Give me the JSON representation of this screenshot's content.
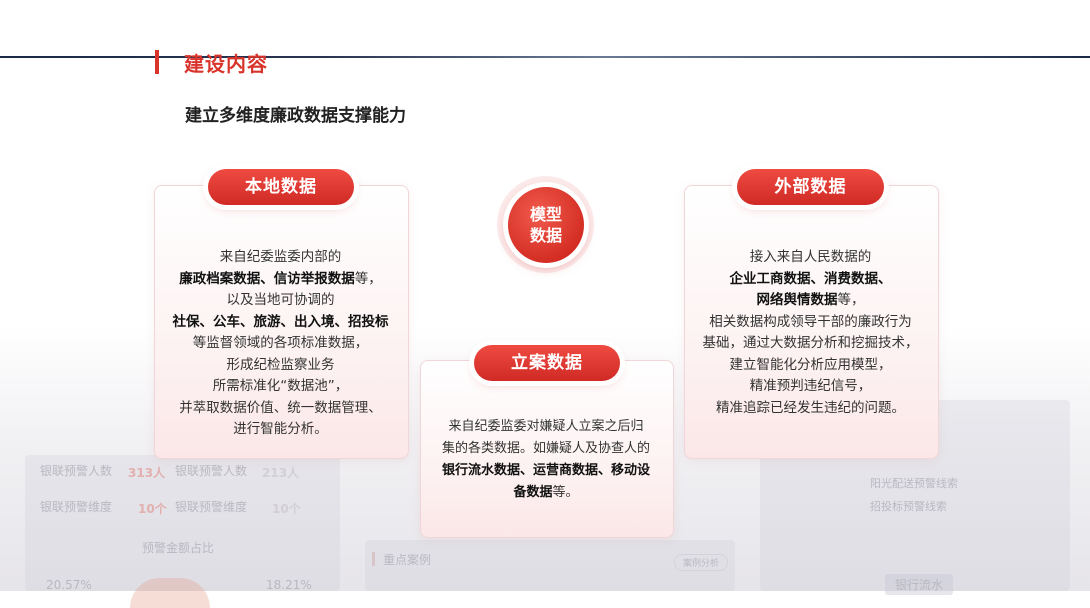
{
  "header": {
    "section_title": "建设内容",
    "subtitle": "建立多维度廉政数据支撑能力"
  },
  "center_badge": {
    "line1": "模型",
    "line2": "数据"
  },
  "cards": {
    "local": {
      "title": "本地数据",
      "l1": "来自纪委监委内部的",
      "l2_b1": "廉政档案数据",
      "l2_sep": "、",
      "l2_b2": "信访举报数据",
      "l2_t": "等，",
      "l3": "以及当地可协调的",
      "l4_b": "社保、公车、旅游、出入境、招投标",
      "l5": "等监督领域的各项标准数据，",
      "l6": "形成纪检监察业务",
      "l7": "所需标准化“数据池”，",
      "l8": "并萃取数据价值、统一数据管理、",
      "l9": "进行智能分析。"
    },
    "external": {
      "title": "外部数据",
      "l1": "接入来自人民数据的",
      "l2_b": "企业工商数据、消费数据、",
      "l3_b": "网络舆情数据",
      "l3_t": "等，",
      "l4": "相关数据构成领导干部的廉政行为",
      "l5": "基础，通过大数据分析和挖掘技术，",
      "l6": "建立智能化分析应用模型，",
      "l7": "精准预判违纪信号，",
      "l8": "精准追踪已经发生违纪的问题。"
    },
    "case": {
      "title": "立案数据",
      "l1": "来自纪委监委对嫌疑人立案之后归",
      "l2": "集的各类数据。如嫌疑人及协查人的",
      "l3_b": "银行流水数据、运营商数据、移动设",
      "l4_b": "备数据",
      "l4_t": "等。"
    }
  },
  "background": {
    "k1": "银联预警人数",
    "v1": "313人",
    "k2": "银联预警人数",
    "v2": "213人",
    "k3": "银联预警维度",
    "v3": "10个",
    "k4": "银联预警维度",
    "v4": "10个",
    "chart_title": "预警金额占比",
    "p1": "20.57%",
    "p2": "18.21%",
    "case_title": "重点案例",
    "case_btn": "案例分析",
    "bank": "银行流水",
    "r1": "阳光配送预警线索",
    "r2": "招投标预警线索"
  }
}
